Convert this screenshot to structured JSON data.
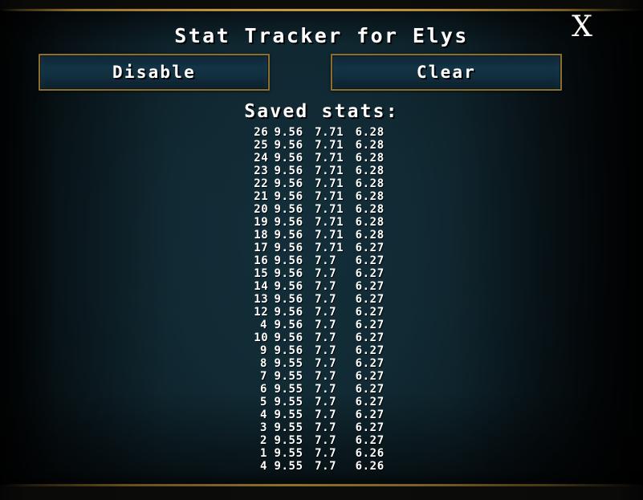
{
  "window": {
    "title": "Stat Tracker for Elys",
    "close_label": "X",
    "close_icon": "close-x-icon"
  },
  "toolbar": {
    "disable_label": "Disable",
    "clear_label": "Clear"
  },
  "stats": {
    "heading": "Saved stats:",
    "rows": [
      {
        "index": "26",
        "v1": "9.56",
        "v2": "7.71",
        "v3": "6.28"
      },
      {
        "index": "25",
        "v1": "9.56",
        "v2": "7.71",
        "v3": "6.28"
      },
      {
        "index": "24",
        "v1": "9.56",
        "v2": "7.71",
        "v3": "6.28"
      },
      {
        "index": "23",
        "v1": "9.56",
        "v2": "7.71",
        "v3": "6.28"
      },
      {
        "index": "22",
        "v1": "9.56",
        "v2": "7.71",
        "v3": "6.28"
      },
      {
        "index": "21",
        "v1": "9.56",
        "v2": "7.71",
        "v3": "6.28"
      },
      {
        "index": "20",
        "v1": "9.56",
        "v2": "7.71",
        "v3": "6.28"
      },
      {
        "index": "19",
        "v1": "9.56",
        "v2": "7.71",
        "v3": "6.28"
      },
      {
        "index": "18",
        "v1": "9.56",
        "v2": "7.71",
        "v3": "6.28"
      },
      {
        "index": "17",
        "v1": "9.56",
        "v2": "7.71",
        "v3": "6.27"
      },
      {
        "index": "16",
        "v1": "9.56",
        "v2": "7.7",
        "v3": "6.27"
      },
      {
        "index": "15",
        "v1": "9.56",
        "v2": "7.7",
        "v3": "6.27"
      },
      {
        "index": "14",
        "v1": "9.56",
        "v2": "7.7",
        "v3": "6.27"
      },
      {
        "index": "13",
        "v1": "9.56",
        "v2": "7.7",
        "v3": "6.27"
      },
      {
        "index": "12",
        "v1": "9.56",
        "v2": "7.7",
        "v3": "6.27"
      },
      {
        "index": "4",
        "v1": "9.56",
        "v2": "7.7",
        "v3": "6.27"
      },
      {
        "index": "10",
        "v1": "9.56",
        "v2": "7.7",
        "v3": "6.27"
      },
      {
        "index": "9",
        "v1": "9.56",
        "v2": "7.7",
        "v3": "6.27"
      },
      {
        "index": "8",
        "v1": "9.55",
        "v2": "7.7",
        "v3": "6.27"
      },
      {
        "index": "7",
        "v1": "9.55",
        "v2": "7.7",
        "v3": "6.27"
      },
      {
        "index": "6",
        "v1": "9.55",
        "v2": "7.7",
        "v3": "6.27"
      },
      {
        "index": "5",
        "v1": "9.55",
        "v2": "7.7",
        "v3": "6.27"
      },
      {
        "index": "4",
        "v1": "9.55",
        "v2": "7.7",
        "v3": "6.27"
      },
      {
        "index": "3",
        "v1": "9.55",
        "v2": "7.7",
        "v3": "6.27"
      },
      {
        "index": "2",
        "v1": "9.55",
        "v2": "7.7",
        "v3": "6.27"
      },
      {
        "index": "1",
        "v1": "9.55",
        "v2": "7.7",
        "v3": "6.26"
      },
      {
        "index": "4",
        "v1": "9.55",
        "v2": "7.7",
        "v3": "6.26"
      }
    ]
  },
  "colors": {
    "panel_blue": "#0d2028",
    "gold_border": "#8a6f2f",
    "text_white": "#ffffff",
    "frame_black": "#0a0907"
  }
}
